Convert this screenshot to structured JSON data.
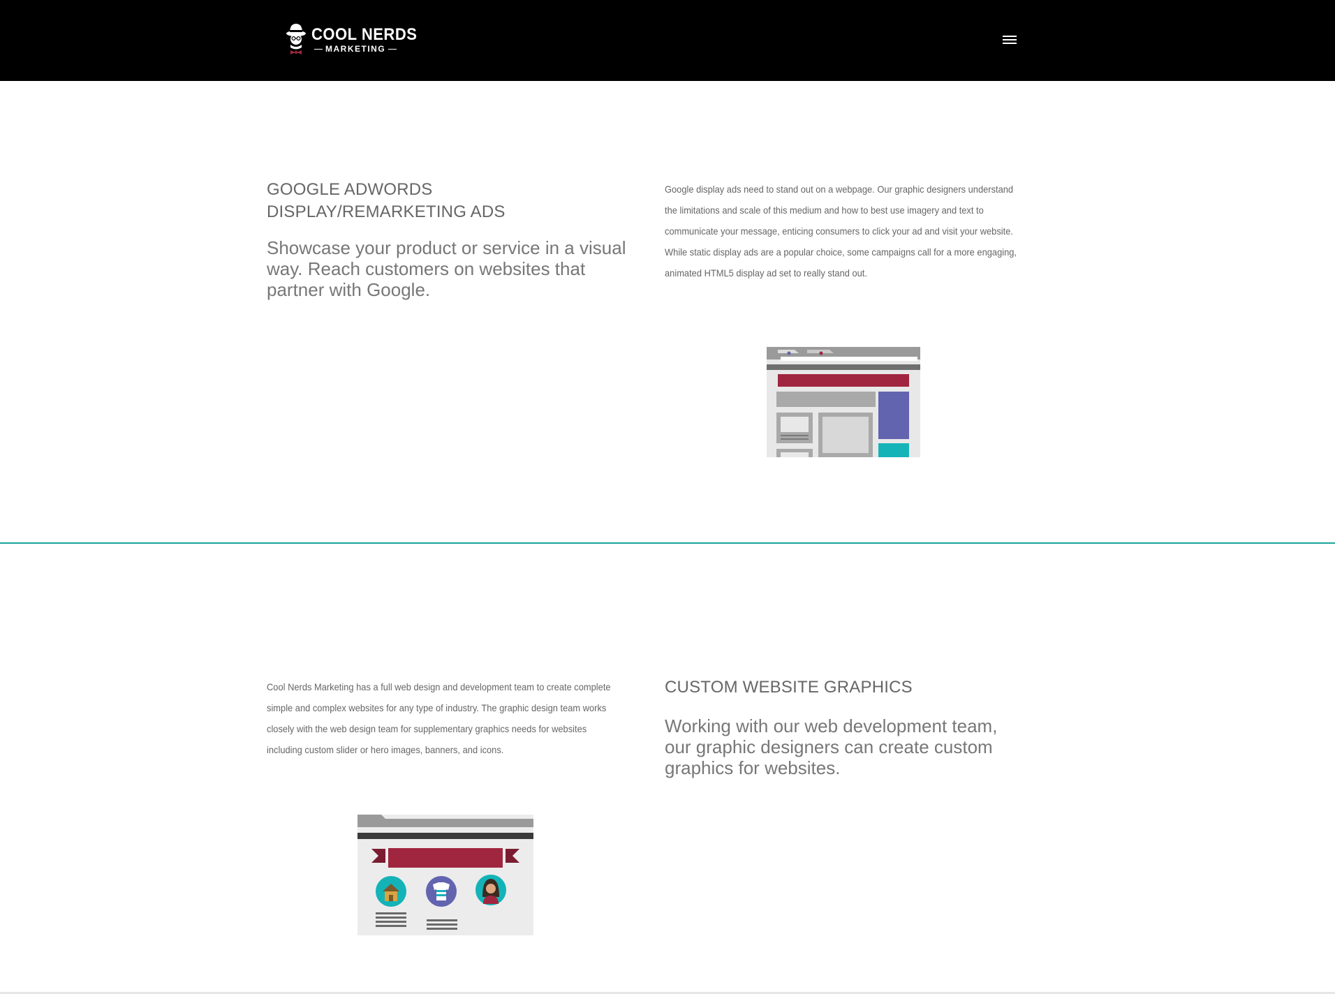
{
  "header": {
    "logo_line1": "COOL NERDS",
    "logo_line2": "MARKETING",
    "menu_icon": "hamburger-menu-icon",
    "background": "#000000"
  },
  "section1": {
    "heading": "GOOGLE ADWORDS DISPLAY/REMARKETING ADS",
    "subheading": "Showcase your product or service in a visual way. Reach customers on websites that partner with Google.",
    "body": "Google display ads need to stand out on a webpage. Our graphic designers understand the limitations and scale of this medium and how to best use imagery and text to communicate your message, enticing consumers to click your ad and visit your website. While static display ads are a popular choice, some campaigns call for a more engaging, animated HTML5 display ad set to really stand out.",
    "illustration": "browser-display-ads-illustration"
  },
  "section2": {
    "body": "Cool Nerds Marketing has a full web design and development team to create complete simple and complex websites for any type of industry. The graphic design team works closely with the web design team for supplementary graphics needs for websites including custom slider or hero images, banners, and icons.",
    "heading": "CUSTOM WEBSITE GRAPHICS",
    "subheading": "Working with our web development team, our graphic designers can create custom graphics for websites.",
    "illustration": "website-graphics-illustration"
  },
  "colors": {
    "accent_teal": "#1aa39a",
    "maroon": "#a0263f",
    "purple": "#6264b0",
    "cyan": "#14b3b8",
    "gray": "#a9a9a9"
  }
}
